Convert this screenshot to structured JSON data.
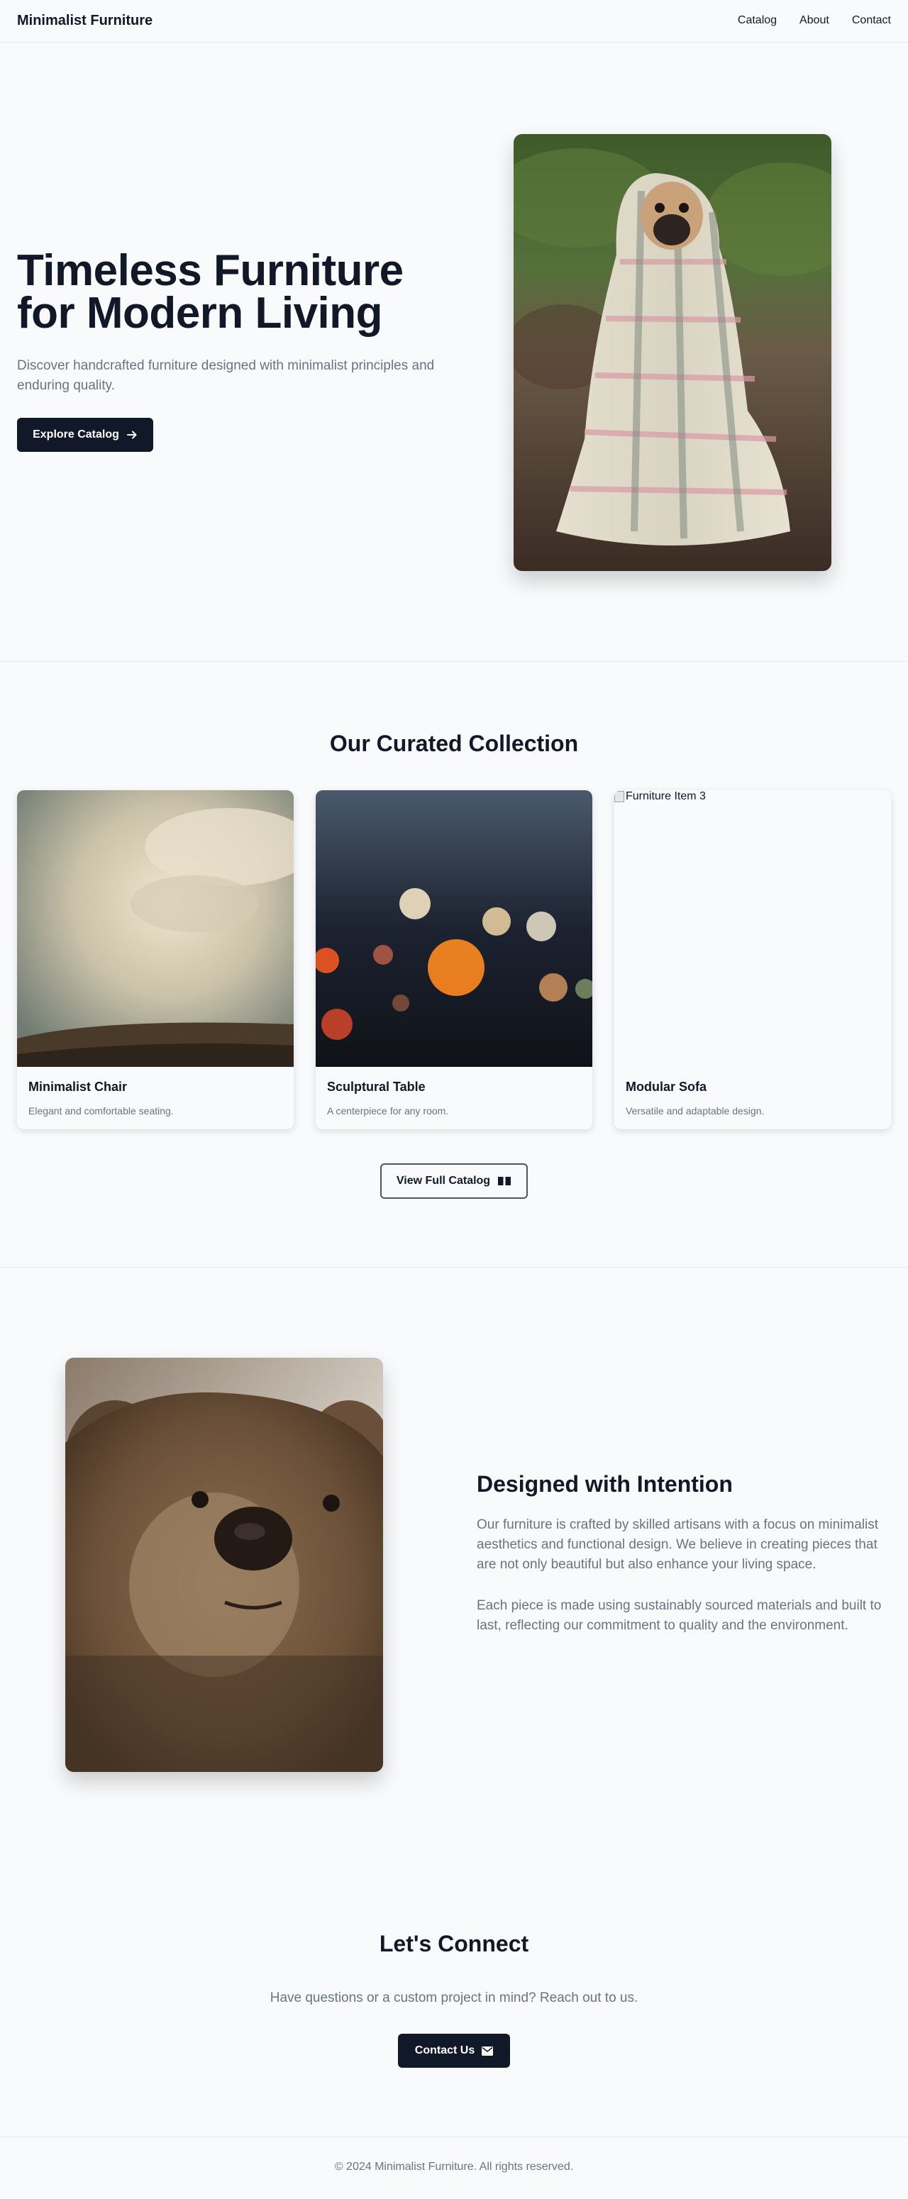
{
  "header": {
    "brand": "Minimalist Furniture",
    "nav": [
      "Catalog",
      "About",
      "Contact"
    ]
  },
  "hero": {
    "title_line1": "Timeless Furniture",
    "title_line2": "for Modern Living",
    "subtitle": "Discover handcrafted furniture designed with minimalist principles and enduring quality.",
    "cta_label": "Explore Catalog",
    "cta_icon": "arrow-right-icon",
    "image_subject": "pug-in-blanket"
  },
  "collection": {
    "title": "Our Curated Collection",
    "items": [
      {
        "name": "Minimalist Chair",
        "desc": "Elegant and comfortable seating.",
        "image_subject": "sky-clouds"
      },
      {
        "name": "Sculptural Table",
        "desc": "A centerpiece for any room.",
        "image_subject": "bokeh-lights"
      },
      {
        "name": "Modular Sofa",
        "desc": "Versatile and adaptable design.",
        "image_alt": "Furniture Item 3"
      }
    ],
    "button_label": "View Full Catalog",
    "button_icon": "book-open-icon"
  },
  "about": {
    "title": "Designed with Intention",
    "paragraphs": [
      "Our furniture is crafted by skilled artisans with a focus on minimalist aesthetics and functional design. We believe in creating pieces that are not only beautiful but also enhance your living space.",
      "Each piece is made using sustainably sourced materials and built to last, reflecting our commitment to quality and the environment."
    ],
    "image_subject": "bear-face"
  },
  "contact": {
    "title": "Let's Connect",
    "subtitle": "Have questions or a custom project in mind? Reach out to us.",
    "button_label": "Contact Us",
    "button_icon": "envelope-icon"
  },
  "footer": {
    "text": "© 2024 Minimalist Furniture. All rights reserved."
  },
  "colors": {
    "background": "#f9fafb",
    "primary_dark": "#111827",
    "muted_text": "#6b7280",
    "border": "#e5e7eb"
  }
}
